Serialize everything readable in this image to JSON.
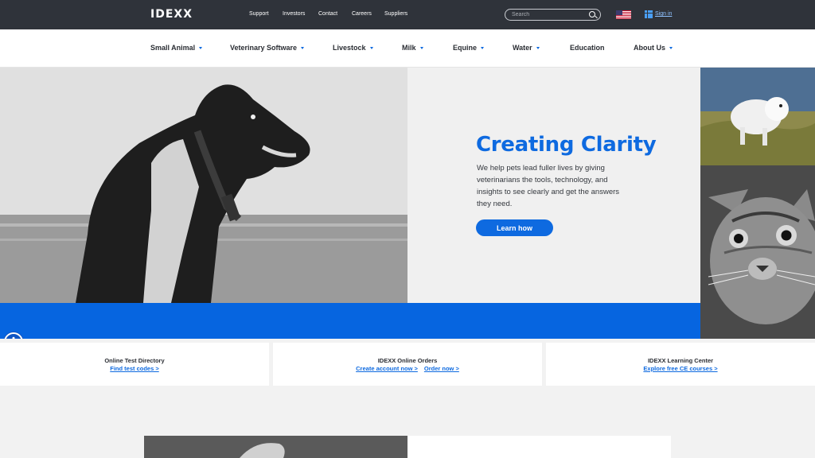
{
  "brand": {
    "logo_text": "IDEXX"
  },
  "utility_nav": {
    "links": [
      "Support",
      "Investors",
      "Contact",
      "Careers",
      "Suppliers"
    ],
    "search_placeholder": "Search",
    "sign_in": "Sign in"
  },
  "main_nav": {
    "items": [
      "Small Animal",
      "Veterinary Software",
      "Livestock",
      "Milk",
      "Equine",
      "Water",
      "Education",
      "About Us"
    ]
  },
  "hero": {
    "title": "Creating Clarity",
    "text": "We help pets lead fuller lives by giving veterinarians the tools, technology, and insights to see clearly and get the answers they need.",
    "button": "Learn how"
  },
  "cards": [
    {
      "title": "Online Test Directory",
      "links": [
        "Find test codes >"
      ]
    },
    {
      "title": "IDEXX Online Orders",
      "links": [
        "Create account now >",
        "Order now >"
      ]
    },
    {
      "title": "IDEXX Learning Center",
      "links": [
        "Explore free CE courses >"
      ]
    }
  ],
  "colors": {
    "accent": "#0e6ae0",
    "topbar": "#2f333a",
    "band": "#0665e0"
  },
  "icons": [
    "search-icon",
    "us-flag-icon",
    "grid-icon",
    "accessibility-icon",
    "caret-down-icon"
  ]
}
